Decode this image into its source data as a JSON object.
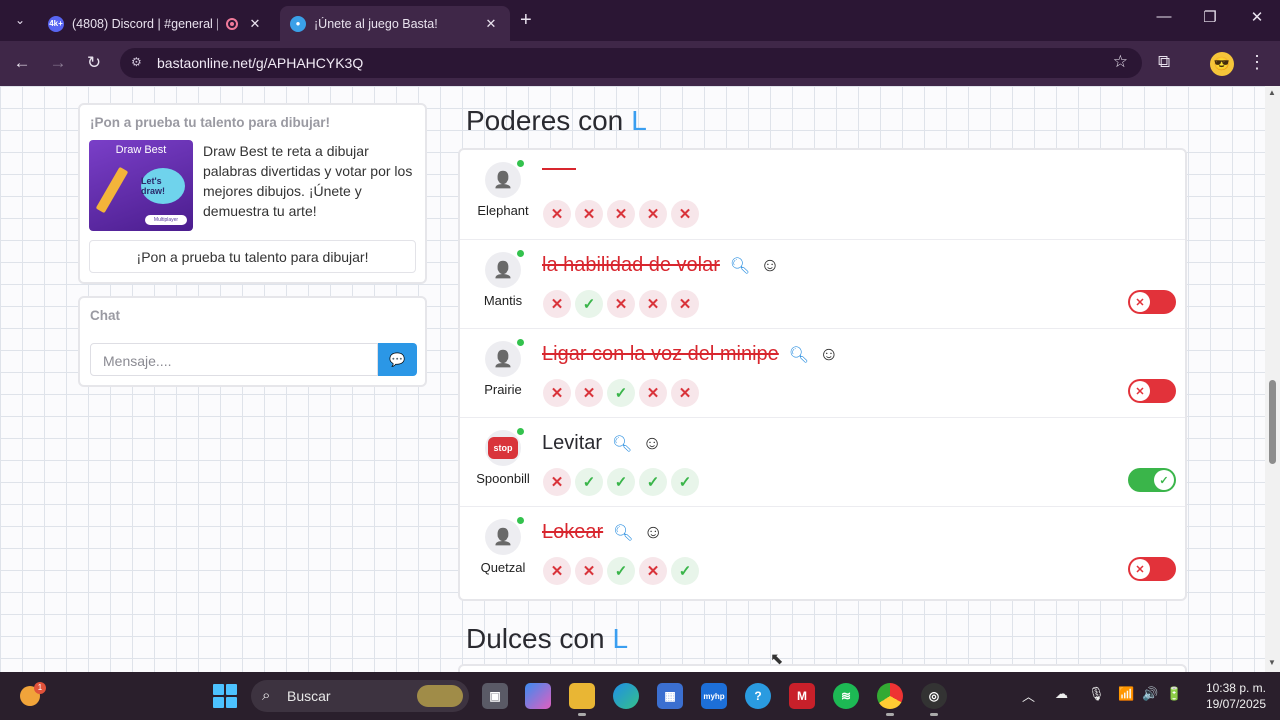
{
  "browser": {
    "tabs": [
      {
        "title": "(4808) Discord | #general |",
        "favicon_badge": "4k+",
        "active": false
      },
      {
        "title": "¡Únete al juego Basta!",
        "active": true
      }
    ],
    "url": "bastaonline.net/g/APHAHCYK3Q",
    "icons": {
      "tab_search": "chevron-down-icon",
      "new_tab": "plus-icon",
      "back": "arrow-left-icon",
      "forward": "arrow-right-icon",
      "reload": "reload-icon",
      "site_info": "tune-icon",
      "bookmark": "star-icon",
      "extensions": "puzzle-icon",
      "menu": "kebab-icon"
    }
  },
  "promo": {
    "heading": "¡Pon a prueba tu talento para dibujar!",
    "thumb_title": "Draw Best",
    "thumb_bubble": "Let's draw!",
    "thumb_badge": "Multiplayer",
    "description": "Draw Best te reta a dibujar palabras divertidas y votar por los mejores dibujos. ¡Únete y demuestra tu arte!",
    "button_label": "¡Pon a prueba tu talento para dibujar!"
  },
  "chat": {
    "heading": "Chat",
    "input_placeholder": "Mensaje...."
  },
  "category": {
    "label": "Poderes con",
    "letter": "L"
  },
  "next_category": {
    "label": "Dulces con",
    "letter": "L"
  },
  "answers": [
    {
      "player": "Elephant",
      "answer": "",
      "avatar": "user-icon",
      "struck": true,
      "votes": [
        "no",
        "no",
        "no",
        "no",
        "no"
      ],
      "toggle": null
    },
    {
      "player": "Mantis",
      "answer": "la habilidad de volar",
      "avatar": "user-icon",
      "struck": true,
      "votes": [
        "no",
        "yes",
        "no",
        "no",
        "no"
      ],
      "toggle": "off"
    },
    {
      "player": "Prairie",
      "answer": "Ligar con la voz del minipe",
      "avatar": "user-icon",
      "struck": true,
      "votes": [
        "no",
        "no",
        "yes",
        "no",
        "no"
      ],
      "toggle": "off"
    },
    {
      "player": "Spoonbill",
      "answer": "Levitar",
      "avatar": "stop-sign",
      "avatar_text": "stop",
      "struck": false,
      "votes": [
        "no",
        "yes",
        "yes",
        "yes",
        "yes"
      ],
      "toggle": "on"
    },
    {
      "player": "Quetzal",
      "answer": "Lokear",
      "avatar": "user-icon",
      "struck": true,
      "votes": [
        "no",
        "no",
        "yes",
        "no",
        "yes"
      ],
      "toggle": "off"
    }
  ],
  "taskbar": {
    "search_label": "Buscar",
    "weather_badge": "1",
    "apps": [
      "task-view-icon",
      "copilot-icon",
      "file-explorer-icon",
      "edge-icon",
      "store-icon",
      "myhp-icon",
      "tips-icon",
      "mcafee-icon",
      "spotify-icon",
      "chrome-icon",
      "obs-icon"
    ],
    "myhp_label": "myhp",
    "time": "10:38 p. m.",
    "date": "19/07/2025"
  }
}
